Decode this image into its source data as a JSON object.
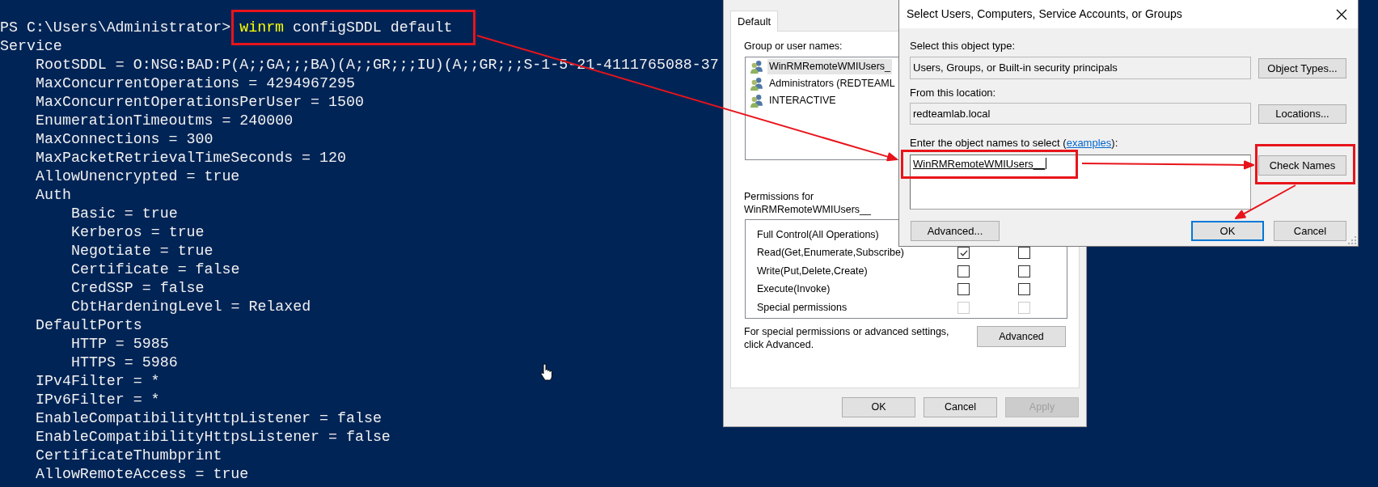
{
  "terminal": {
    "prompt": "PS C:\\Users\\Administrator>",
    "command": {
      "name": "winrm",
      "arguments": "configSDDL default"
    },
    "output": [
      {
        "text": "Service",
        "children": [
          {
            "text": "RootSDDL = O:NSG:BAD:P(A;;GA;;;BA)(A;;GR;;;IU)(A;;GR;;;S-1-5-21-4111765088-37"
          },
          {
            "text": "MaxConcurrentOperations = 4294967295"
          },
          {
            "text": "MaxConcurrentOperationsPerUser = 1500"
          },
          {
            "text": "EnumerationTimeoutms = 240000"
          },
          {
            "text": "MaxConnections = 300"
          },
          {
            "text": "MaxPacketRetrievalTimeSeconds = 120"
          },
          {
            "text": "AllowUnencrypted = true"
          },
          {
            "text": "Auth",
            "children": [
              {
                "text": "Basic = true"
              },
              {
                "text": "Kerberos = true"
              },
              {
                "text": "Negotiate = true"
              },
              {
                "text": "Certificate = false"
              },
              {
                "text": "CredSSP = false"
              },
              {
                "text": "CbtHardeningLevel = Relaxed"
              }
            ]
          },
          {
            "text": "DefaultPorts",
            "children": [
              {
                "text": "HTTP = 5985"
              },
              {
                "text": "HTTPS = 5986"
              }
            ]
          },
          {
            "text": "IPv4Filter = *"
          },
          {
            "text": "IPv6Filter = *"
          },
          {
            "text": "EnableCompatibilityHttpListener = false"
          },
          {
            "text": "EnableCompatibilityHttpsListener = false"
          },
          {
            "text": "CertificateThumbprint"
          },
          {
            "text": "AllowRemoteAccess = true"
          }
        ]
      }
    ]
  },
  "permissions_dialog": {
    "tabs": [
      {
        "label": "Default",
        "selected": true
      }
    ],
    "principals_label": "Group or user names:",
    "principals": [
      {
        "name": "WinRMRemoteWMIUsers_",
        "selected": true
      },
      {
        "name": "Administrators (REDTEAML",
        "selected": false
      },
      {
        "name": "INTERACTIVE",
        "selected": false
      }
    ],
    "permissions_label": "Permissions for WinRMRemoteWMIUsers__",
    "permissions": [
      {
        "label": "Full Control(All Operations)"
      },
      {
        "label": "Read(Get,Enumerate,Subscribe)",
        "allow": {
          "checked": true,
          "disabled": false
        },
        "deny": {
          "checked": false,
          "disabled": false
        }
      },
      {
        "label": "Write(Put,Delete,Create)",
        "allow": {
          "checked": false,
          "disabled": false
        },
        "deny": {
          "checked": false,
          "disabled": false
        }
      },
      {
        "label": "Execute(Invoke)",
        "allow": {
          "checked": false,
          "disabled": false
        },
        "deny": {
          "checked": false,
          "disabled": false
        }
      },
      {
        "label": "Special permissions",
        "allow": {
          "checked": false,
          "disabled": true
        },
        "deny": {
          "checked": false,
          "disabled": true
        }
      }
    ],
    "advanced_hint": "For special permissions or advanced settings, click Advanced.",
    "advanced_button": "Advanced",
    "buttons": [
      {
        "label": "OK",
        "disabled": false
      },
      {
        "label": "Cancel",
        "disabled": false
      },
      {
        "label": "Apply",
        "disabled": true
      }
    ]
  },
  "select_dialog": {
    "title": "Select Users, Computers, Service Accounts, or Groups",
    "object_type_label": "Select this object type:",
    "object_type": "Users, Groups, or Built-in security principals",
    "object_types_button": "Object Types...",
    "location_label": "From this location:",
    "location": "redteamlab.local",
    "locations_button": "Locations...",
    "names_label": "Enter the object names to select (",
    "examples_link": "examples",
    "names_label_end": "):",
    "names_value": "WinRMRemoteWMIUsers__",
    "names_resolved": true,
    "names_focused": true,
    "check_names_button": "Check Names",
    "advanced_button": "Advanced...",
    "buttons": [
      {
        "label": "OK",
        "default": true
      },
      {
        "label": "Cancel",
        "default": false
      }
    ]
  }
}
